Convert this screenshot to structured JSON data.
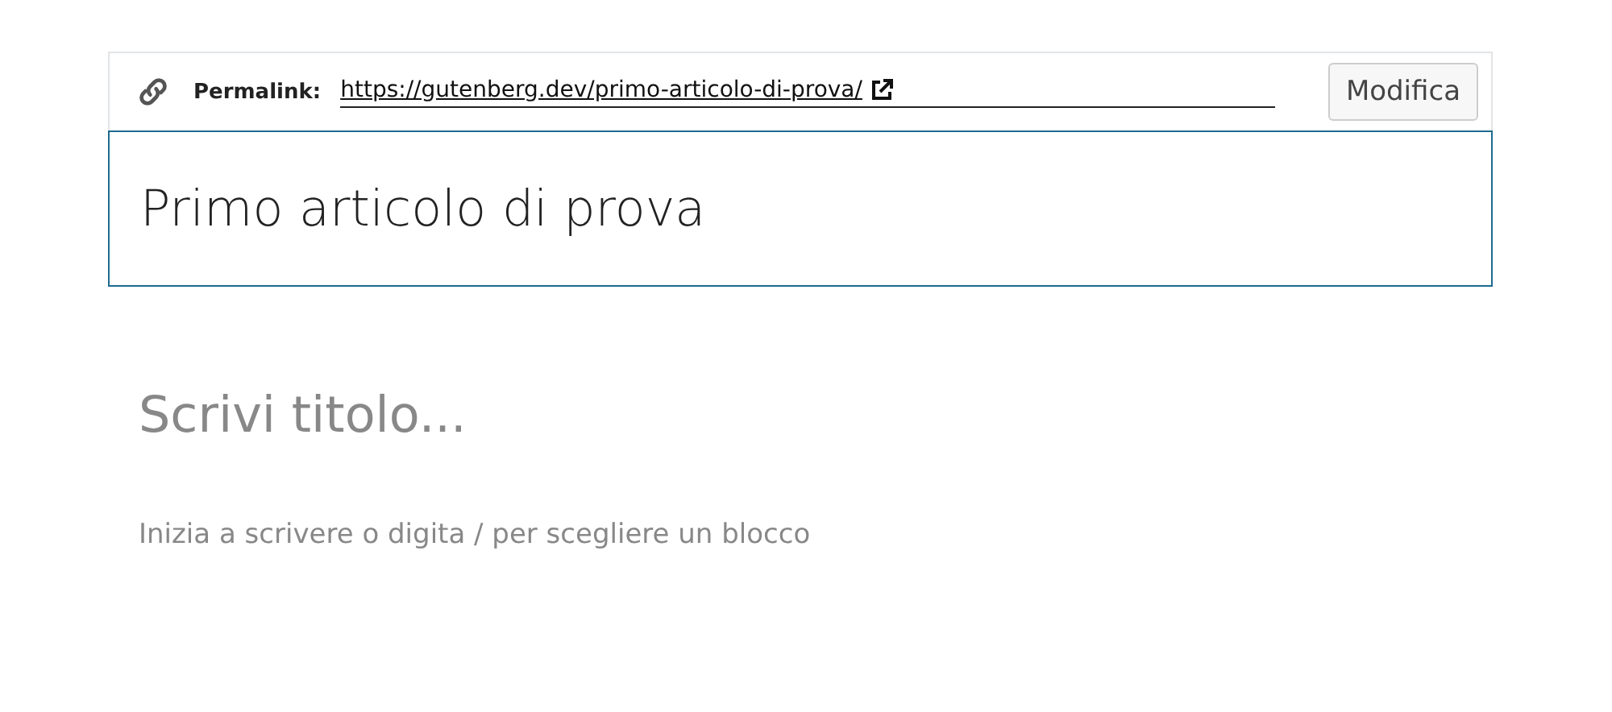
{
  "permalink": {
    "label": "Permalink:",
    "url": "https://gutenberg.dev/primo-articolo-di-prova/",
    "button": "Modifica"
  },
  "post_title": {
    "value": "Primo articolo di prova"
  },
  "title_block": {
    "placeholder": "Scrivi titolo..."
  },
  "body": {
    "placeholder": "Inizia a scrivere o digita / per scegliere un blocco"
  }
}
